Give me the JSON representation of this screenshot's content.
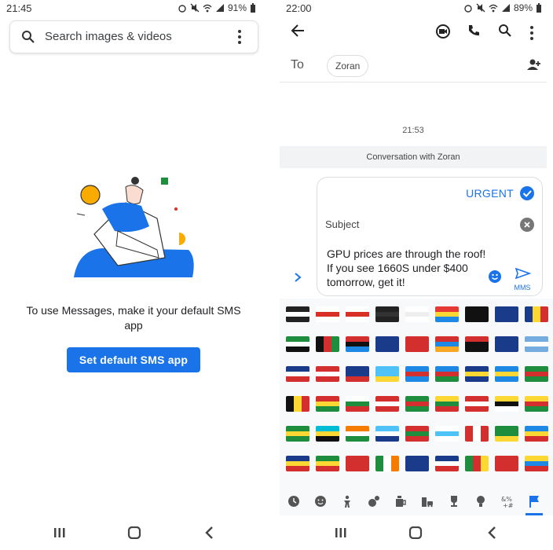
{
  "left": {
    "status": {
      "time": "21:45",
      "battery": "91%"
    },
    "search": {
      "placeholder": "Search images & videos"
    },
    "message": "To use Messages, make it your default SMS app",
    "button": "Set default SMS app"
  },
  "right": {
    "status": {
      "time": "22:00",
      "battery": "89%"
    },
    "to_label": "To",
    "recipient_chip": "Zoran",
    "timestamp": "21:53",
    "conversation_banner": "Conversation with Zoran",
    "compose": {
      "urgent_label": "URGENT",
      "subject_label": "Subject",
      "message_text": "GPU prices are through the roof! If you see 1660S under $400 tomorrow, get it!",
      "send_label": "MMS"
    },
    "emoji_category_active": "flags",
    "emoji_categories": [
      "recent",
      "smileys",
      "people",
      "activities",
      "food",
      "travel",
      "objects",
      "symbols",
      "flags"
    ]
  },
  "colors": {
    "accent": "#1a73e8",
    "banner": "#f1f3f4"
  }
}
